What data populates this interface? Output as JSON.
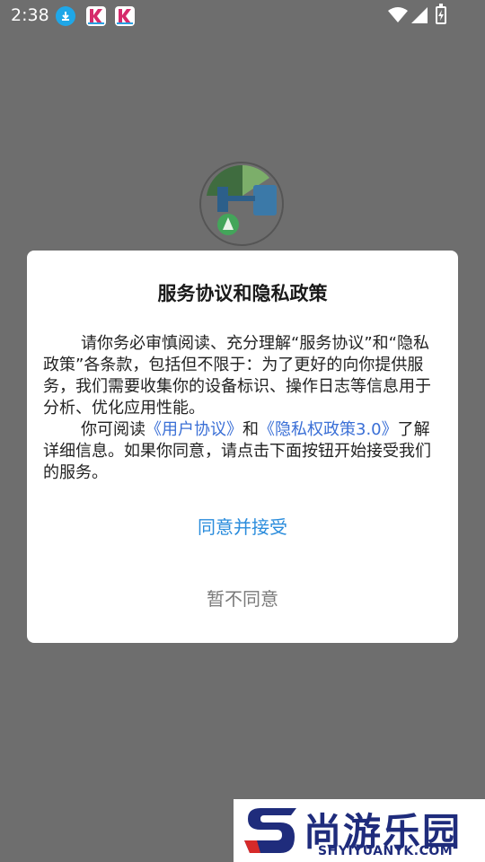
{
  "status_bar": {
    "time": "2:38",
    "icons": [
      "download-icon",
      "k-app-icon",
      "k-app-icon",
      "wifi-icon",
      "signal-icon",
      "battery-icon"
    ]
  },
  "dialog": {
    "title": "服务协议和隐私政策",
    "para1": "请你务必审慎阅读、充分理解“服务协议”和“隐私政策”各条款，包括但不限于：为了更好的向你提供服务，我们需要收集你的设备标识、操作日志等信息用于分析、优化应用性能。",
    "para2_prefix": "你可阅读",
    "user_agreement_link": "《用户协议》",
    "and_text": "和",
    "privacy_link": "《隐私权政策3.0》",
    "para2_suffix": "了解详细信息。如果你同意，请点击下面按钮开始接受我们的服务。",
    "agree_label": "同意并接受",
    "decline_label": "暂不同意"
  },
  "watermark": {
    "brand": "尚游乐园",
    "domain": "SHYIYUANYK.COM"
  },
  "colors": {
    "overlay": "#6e6e6e",
    "link": "#3a6fd6",
    "accent": "#2a8cdc",
    "brand": "#1f2c7c"
  }
}
